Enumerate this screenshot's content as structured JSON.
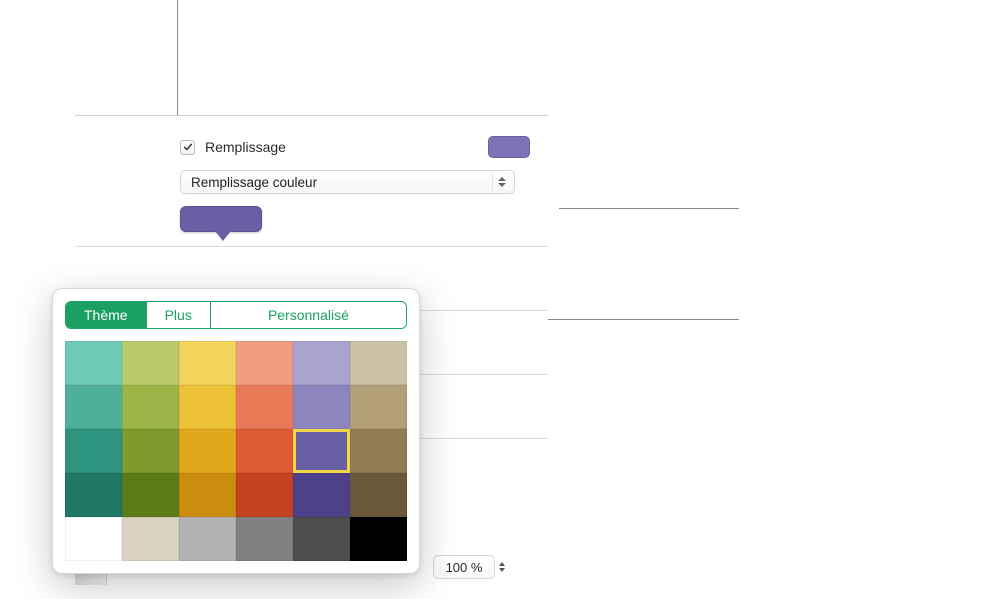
{
  "inspector": {
    "fill_checkbox_label": "Remplissage",
    "fill_checked": true,
    "fill_swatch_color": "#7d74b5",
    "fill_type_select": "Remplissage couleur",
    "color_well": "#6a5ea4",
    "opacity_value": "100 %"
  },
  "popover": {
    "segments": {
      "theme": "Thème",
      "more": "Plus",
      "custom": "Personnalisé",
      "selected_index": 0
    },
    "grid": {
      "cols": 6,
      "rows": 5,
      "selected_index": 16,
      "colors": [
        "#6fc9b7",
        "#b9ca6d",
        "#f3d45b",
        "#f39d80",
        "#a9a3cf",
        "#cdc2a5",
        "#4eb09a",
        "#9db548",
        "#edc135",
        "#e87a57",
        "#8d86be",
        "#b2a178",
        "#2e9480",
        "#7e9b2e",
        "#e2a81c",
        "#de5a35",
        "#6a5ea4",
        "#8f7d56",
        "#1f7766",
        "#5b7a18",
        "#cc8d0f",
        "#c6411f",
        "#4d4289",
        "#6a5a3a",
        "#ffffff",
        "#d8d2c0",
        "#b2b2b2",
        "#808080",
        "#4d4d4d",
        "#000000"
      ]
    }
  },
  "icons": {
    "checkmark": "checkmark-icon",
    "updown": "chevrons-updown-icon"
  },
  "accent_color": "#1aa061"
}
